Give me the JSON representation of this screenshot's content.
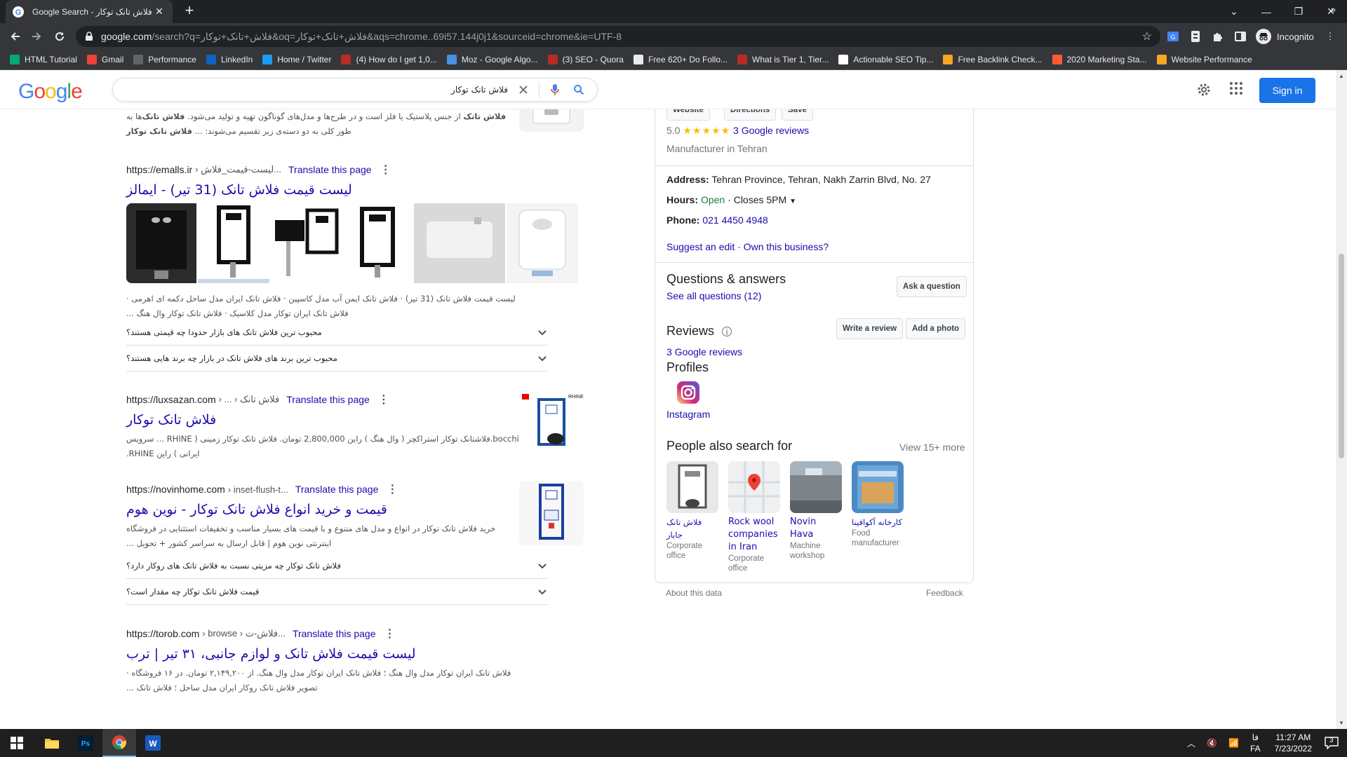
{
  "browser": {
    "tab_title": "Google Search - فلاش تانک توکار",
    "url_host": "google.com",
    "url_rest": "/search?q=فلاش+تانک+توکار&oq=فلاش+تانک+توکار&aqs=chrome..69i57.144j0j1&sourceid=chrome&ie=UTF-8",
    "profile_label": "Incognito",
    "bookmarks": [
      {
        "label": "HTML Tutorial",
        "icon": "w3-icon",
        "color": "#04aa6d"
      },
      {
        "label": "Gmail",
        "icon": "gmail-icon",
        "color": "#ea4335"
      },
      {
        "label": "Performance",
        "icon": "performance-icon",
        "color": "#5f6368"
      },
      {
        "label": "LinkedIn",
        "icon": "linkedin-icon",
        "color": "#0a66c2"
      },
      {
        "label": "Home / Twitter",
        "icon": "twitter-icon",
        "color": "#1d9bf0"
      },
      {
        "label": "(4) How do I get 1,0...",
        "icon": "quora-icon",
        "color": "#b92b27"
      },
      {
        "label": "Moz - Google Algo...",
        "icon": "moz-icon",
        "color": "#4a90e2"
      },
      {
        "label": "(3) SEO - Quora",
        "icon": "quora-icon",
        "color": "#b92b27"
      },
      {
        "label": "Free 620+ Do Follo...",
        "icon": "globe-icon",
        "color": "#e8eaed"
      },
      {
        "label": "What is Tier 1, Tier...",
        "icon": "quora-icon",
        "color": "#b92b27"
      },
      {
        "label": "Actionable SEO Tip...",
        "icon": "seo-icon",
        "color": "#ffffff"
      },
      {
        "label": "Free Backlink Check...",
        "icon": "ahrefs-icon",
        "color": "#f5a623"
      },
      {
        "label": "2020 Marketing Sta...",
        "icon": "hubspot-icon",
        "color": "#ff5c35"
      },
      {
        "label": "Website Performance",
        "icon": "pin-icon",
        "color": "#f5a623"
      }
    ]
  },
  "google": {
    "logo_text": "Google",
    "query": "فلاش تانک توکار",
    "signin_label": "Sign in"
  },
  "results": {
    "top_snippet": {
      "line1_pre": "",
      "line1_bold": "فلاش تانک",
      "line1_post": " از جنس پلاستیک یا فلز است و در طرح‌ها و مدل‌های گوناگون تهیه و تولید می‌شود. ",
      "line1_bold2": "فلاش تانک‌",
      "line1_post2": "ها به طور کلی به دو دسته‌ی زیر تقسیم می‌شوند: ... ",
      "line1_bold3": "فلاش تانک توکار"
    },
    "emalls": {
      "domain": "https://emalls.ir",
      "path": "› لیست-قیمت_فلاش...",
      "translate": "Translate this page",
      "title": "لیست قیمت فلاش تانک (31 تیر) - ایمالز",
      "snippet": "لیست قیمت فلاش تانک (31 تیر) · فلاش تانک ایمن آب مدل کاسپین · فلاش تانک ایران مدل ساحل دکمه ای اهرمی · فلاش تانک ایران توکار مدل کلاسیک · فلاش تانک توکار وال هنگ ...",
      "paa": [
        "محبوب ترین فلاش تانک های بازار حدودا چه قیمتی هستند؟",
        "محبوب ترین برند های فلاش تانک در بازار چه برند هایی هستند؟"
      ]
    },
    "luxsazan": {
      "domain": "https://luxsazan.com",
      "path": "› ... › فلاش تانک",
      "translate": "Translate this page",
      "title": "فلاش تانک توکار",
      "snippet": "bocchi.فلاشتانک توکار استراکچر ( وال هنگ ) راین 2,800,000 تومان. فلاش تانک توکار زمینی ( RHINE ... سرویس ایرانی ) راین RHINE."
    },
    "novinhome": {
      "domain": "https://novinhome.com",
      "path": "› inset-flush-t...",
      "translate": "Translate this page",
      "title": "قیمت و خرید انواع فلاش تانک توکار - نوین هوم",
      "snippet": "خرید فلاش تانک توکار در انواع و مدل های متنوع و با قیمت های بسیار مناسب و تخفیفات استثنایی در فروشگاه اینترنتی نوین هوم | قابل ارسال به سراسر کشور + تحویل ...",
      "paa": [
        "فلاش تانک توکار چه مزیتی نسبت به فلاش تانک های روکار دارد؟",
        "قیمت فلاش تانک توکار چه مقدار است؟"
      ]
    },
    "torob": {
      "domain": "https://torob.com",
      "path": "› browse › فلاش-ت...",
      "translate": "Translate this page",
      "title": "لیست قیمت فلاش تانک و لوازم جانبی، ۳۱ تیر | ترب",
      "snippet": "فلاش تانک ایران توکار مدل وال هنگ ؛ فلاش تانک ایران توکار مدل وال هنگ. از ۲,۱۴۹,۲۰۰ تومان. در ۱۶ فروشگاه · تصویر فلاش تانک روکار ایران مدل ساحل ؛ فلاش تانک ..."
    }
  },
  "knowledge_panel": {
    "buttons": [
      "Website",
      "Directions",
      "Save"
    ],
    "rating": "5.0",
    "stars": "★★★★★",
    "reviews_link": "3 Google reviews",
    "category": "Manufacturer in Tehran",
    "address_label": "Address:",
    "address": "Tehran Province, Tehran, Nakh Zarrin Blvd, No. 27",
    "hours_label": "Hours:",
    "hours_open": "Open",
    "hours_close": " · Closes 5PM",
    "phone_label": "Phone:",
    "phone": "021 4450 4948",
    "suggest_edit": "Suggest an edit",
    "own_business": "Own this business?",
    "qa_title": "Questions & answers",
    "qa_link": "See all questions (12)",
    "ask_btn": "Ask a question",
    "reviews_title": "Reviews",
    "write_review": "Write a review",
    "add_photo": "Add a photo",
    "reviews_link2": "3 Google reviews",
    "profiles_title": "Profiles",
    "instagram": "Instagram",
    "pasf_title": "People also search for",
    "view_more": "View 15+ more",
    "pasf": [
      {
        "name": "فلاش تانک جابار",
        "type": "Corporate office"
      },
      {
        "name": "Rock wool companies in Iran",
        "type": "Corporate office"
      },
      {
        "name": "Novin Hava",
        "type": "Machine workshop"
      },
      {
        "name": "کارخانه آکوافینا",
        "type": "Food manufacturer"
      }
    ],
    "about_data": "About this data",
    "feedback": "Feedback"
  },
  "taskbar": {
    "time": "11:27 AM",
    "date": "7/23/2022",
    "lang_top": "فا",
    "lang_bottom": "FA",
    "notif_count": "3"
  }
}
